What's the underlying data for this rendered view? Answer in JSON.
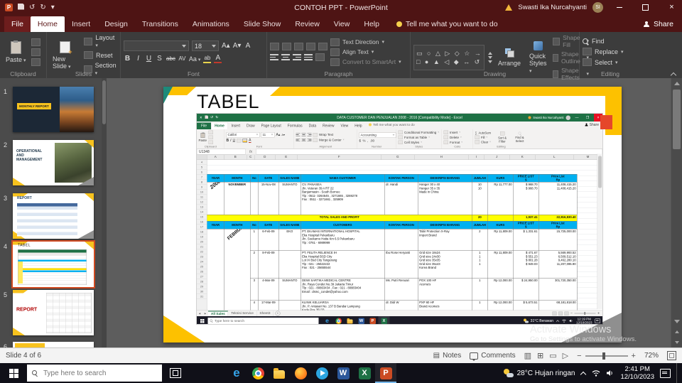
{
  "ppt": {
    "titlebar": {
      "title": "CONTOH PPT - PowerPoint",
      "user": "Swasti Ika Nurcahyanti",
      "avatar_initials": "SI"
    },
    "tabs": [
      "File",
      "Home",
      "Insert",
      "Design",
      "Transitions",
      "Animations",
      "Slide Show",
      "Review",
      "View",
      "Help"
    ],
    "active_tab": "Home",
    "tell_me": "Tell me what you want to do",
    "share_label": "Share",
    "ribbon": {
      "paste": "Paste",
      "clipboard_group": "Clipboard",
      "new_slide": "New Slide",
      "layout": "Layout",
      "reset": "Reset",
      "section": "Section",
      "slides_group": "Slides",
      "font_size": "18",
      "font_group": "Font",
      "text_direction": "Text Direction",
      "align_text": "Align Text",
      "smartart": "Convert to SmartArt",
      "paragraph_group": "Paragraph",
      "arrange": "Arrange",
      "quick_styles": "Quick Styles",
      "shape_fill": "Shape Fill",
      "shape_outline": "Shape Outline",
      "shape_effects": "Shape Effects",
      "drawing_group": "Drawing",
      "find": "Find",
      "replace": "Replace",
      "select": "Select",
      "editing_group": "Editing"
    },
    "thumbnails": [
      {
        "num": "1",
        "kind": "monthly",
        "label": "MONTHLY REPORT"
      },
      {
        "num": "2",
        "kind": "operational",
        "label": "OPERATIONAL AND MANAGEMENT"
      },
      {
        "num": "3",
        "kind": "report-blue",
        "label": "REPORT"
      },
      {
        "num": "4",
        "kind": "tabel",
        "label": "TABEL",
        "selected": true
      },
      {
        "num": "5",
        "kind": "report-red",
        "label": "REPORT"
      },
      {
        "num": "6",
        "kind": "partial",
        "label": ""
      }
    ],
    "status": {
      "slide_indicator": "Slide 4 of 6",
      "notes": "Notes",
      "comments": "Comments",
      "zoom": "72%"
    }
  },
  "slide": {
    "title": "TABEL"
  },
  "excel": {
    "titlebar": {
      "title": "DATA CUSTOMER DAN PENJUALAN 2008 - 2016  [Compatibility Mode] - Excel",
      "user": "Swasti Ika Nurcahyanti"
    },
    "tabs": [
      "File",
      "Home",
      "Insert",
      "Draw",
      "Page Layout",
      "Formulas",
      "Data",
      "Review",
      "View",
      "Help"
    ],
    "active_tab": "Home",
    "tell_me": "Tell me what you want to do",
    "share_label": "Share",
    "ribbon": {
      "paste": "Paste",
      "font_name": "Calibri",
      "font_size": "11",
      "wrap_text": "Wrap Text",
      "merge_center": "Merge & Center",
      "number_format": "Accounting",
      "cond_format": "Conditional Formatting",
      "format_table": "Format as Table",
      "cell_styles": "Cell Styles",
      "insert": "Insert",
      "delete": "Delete",
      "format": "Format",
      "autosum": "AutoSum",
      "fill": "Fill",
      "clear": "Clear",
      "sort_filter": "Sort & Filter",
      "find_select": "Find & Select",
      "groups": [
        "Clipboard",
        "Font",
        "Alignment",
        "Number",
        "Styles",
        "Cells",
        "Editing"
      ]
    },
    "name_box": "U1348",
    "columns": [
      "A",
      "B",
      "C",
      "D",
      "E",
      "F",
      "G",
      "H",
      "I",
      "J",
      "K",
      "L",
      "M"
    ],
    "row_numbers": [
      "4",
      "5",
      "6",
      "7",
      "8",
      "9",
      "10",
      "11",
      "12",
      "13",
      "14",
      "15",
      "16",
      "17",
      "18",
      "19",
      "20",
      "21",
      "22",
      "23",
      "24",
      "25",
      "26",
      "27",
      "28",
      "29",
      "30",
      "31"
    ],
    "table": {
      "header1": [
        "YEAR",
        "MONTH",
        "No",
        "DATE",
        "SALES NAME",
        "NAMA CUSTOMER",
        "KONTAK PERSON",
        "DESKRIPSI BARANG",
        "JUMLAH",
        "KURS",
        "PRICE LIST\n$",
        "Price List\nRp"
      ],
      "year1": "2008",
      "month1": "NOVEMBER",
      "rows1": [
        {
          "no": "",
          "date": "15-Nov-08",
          "sales": "SUMANTO",
          "customer": "CV. PANASEA\nJln. Veteran 39 A RT 22\nBanjarmasin - South Borneo\nTlp : 0511- 3264545 , 3271665 , 3269278\nFax : 0511 - 3271661 , 325909",
          "contact": "dr. Handi",
          "desc": "Hanger 30 x 40\nHanger 35 x 35\nMade in China",
          "qty": "10\n10",
          "kurs": "Rp  11,777.00",
          "usd": "$      968.70\n$      968.70",
          "rp": "11,408,415.20\n11,408,415.20"
        }
      ],
      "total_label": "TOTAL SALES AND PROFIT",
      "total_qty": "20",
      "total_usd": "1,937.41",
      "total_rp": "22,816,830.40",
      "header2": [
        "YEAR",
        "MONTH",
        "No",
        "DATE",
        "SALES NAME",
        "CUSTOMERS",
        "KONTAK PERSON",
        "DESKRIPSI BARANG",
        "JUMLAH",
        "KURS",
        "PRICE LIST\n$",
        "Price List\nRp"
      ],
      "month2": "FEBRUARI",
      "rows2": [
        {
          "no": "1",
          "date": "6-Feb-09",
          "sales": "EKO",
          "customer": "PT. EKAMAS INTERNATIONAL HOSPITAL\nEka Hospital Pekanbaru\nJln. Soekarno Hatta Km 6.5 Pekanbaru\nTlp : 0761 - 6989999",
          "contact": "",
          "desc": "Tabir Protection X-Ray\nImport Brand",
          "qty": "2",
          "kurs": "Rp  11,809.00",
          "usd": "$   1,331.61",
          "rp": "15,725,000.00"
        },
        {
          "no": "2",
          "date": "8-Feb-09",
          "sales": "",
          "customer": "PT. FELITA RELIENCE IH\nEka Hospital BSD City\nLot IX Bsd City Tangerang\nTlp : 021 - 25622222\nFax : 021 - 25655544",
          "contact": "Ibu Rose Heryanti",
          "desc": "Grid size 18x24\nGrid size 24x30\nGrid size 35x35\nGrid size 35x43\nKorea Brand",
          "qty": "1\n1\n1\n1",
          "kurs": "Rp  11,809.00",
          "usd": "$      471.67\n$      551.23\n$      801.28\n$      949.03",
          "rp": "5,569,993.52\n6,509,512.10\n9,462,280.10\n11,207,095.90"
        },
        {
          "no": "3",
          "date": "4-Mar-09",
          "sales": "SUMANTO",
          "customer": "DEWI SARTIKA MEDICAL CENTRE\nJln. Raya Condet No.39 Jakarta Timur\nTlp : 021 - 80863434 , Fax : 021 - 80883404\nEmail : dsmc_condet@yahoo.com",
          "contact": "Ms. Putri Renoari",
          "desc": "POX 100 HF\nAcoma's",
          "qty": "1",
          "kurs": "Rp  12,093.00",
          "usd": "$ 24,950.00",
          "rp": "301,720,350.00"
        },
        {
          "no": "4",
          "date": "17-Mar-09",
          "sales": "",
          "customer": "KLINIK KELUARGA\nJln. P. Antasari No. 137 B Bandar Lampung\nKode Pos 35133",
          "contact": "dr. Didi W",
          "desc": "PXP 60 HF\nBrand Acoma's",
          "qty": "1",
          "kurs": "Rp  12,093.00",
          "usd": "$   5,673.51",
          "rp": "68,181,818.00"
        }
      ]
    },
    "sheet_tabs": [
      "All Sales",
      "Teknisi Service",
      "Sheet3"
    ],
    "active_sheet": "All Sales",
    "taskbar": {
      "search": "Type here to search",
      "weather": "31°C Berawan",
      "time": "12:19 PM",
      "date": "12/10/2023",
      "apps": [
        "edge",
        "chrome",
        "folder",
        "word",
        "powerpoint",
        "excel"
      ],
      "active_app": "excel"
    },
    "watermark": {
      "line1": "Activate Windows",
      "line2": "Go to Settings to activate Windows."
    }
  },
  "watermark": {
    "line1": "Activate Windows",
    "line2": "Go to Settings to activate Windows."
  },
  "taskbar": {
    "search_placeholder": "Type here to search",
    "weather": "28°C Hujan ringan",
    "time": "2:41 PM",
    "date": "12/10/2023",
    "apps": [
      "edge",
      "chrome",
      "folder",
      "firefox",
      "telegram",
      "word",
      "excel",
      "powerpoint"
    ],
    "active_app": "powerpoint"
  }
}
